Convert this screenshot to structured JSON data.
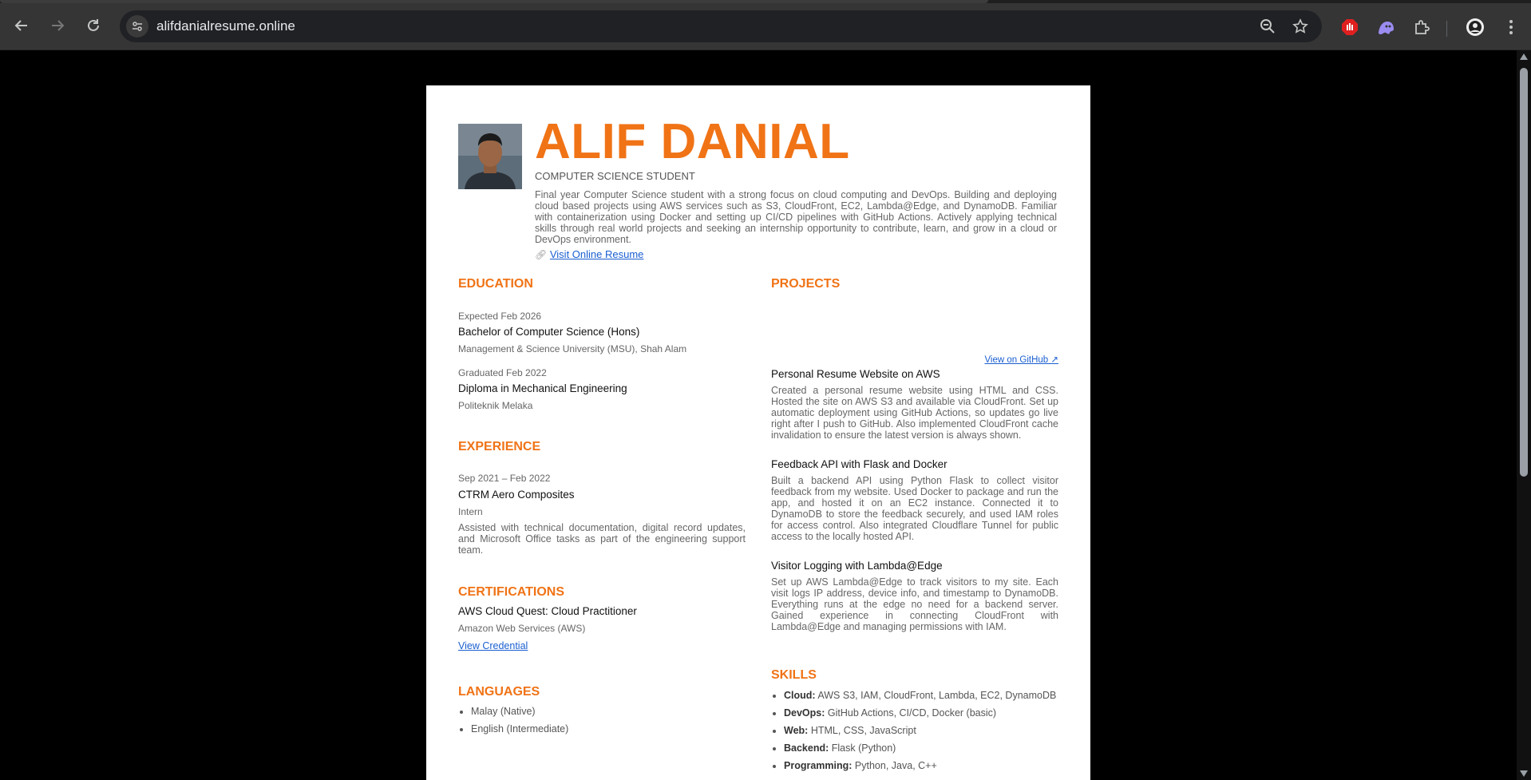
{
  "browser": {
    "url": "alifdanialresume.online",
    "colors": {
      "toolbar": "#353535",
      "omnibox": "#202124"
    }
  },
  "resume": {
    "name": "ALIF DANIAL",
    "subtitle": "COMPUTER SCIENCE STUDENT",
    "summary": "Final year Computer Science student with a strong focus on cloud computing and DevOps. Building and deploying cloud based projects using AWS services such as S3, CloudFront, EC2, Lambda@Edge, and DynamoDB. Familiar with containerization using Docker and setting up CI/CD pipelines with GitHub Actions. Actively applying technical skills through real world projects and seeking an internship opportunity to contribute, learn, and grow in a cloud or DevOps environment.",
    "online_link": "Visit Online Resume",
    "accent_color": "#f07316",
    "education": {
      "heading": "EDUCATION",
      "items": [
        {
          "date": "Expected Feb 2026",
          "degree": "Bachelor of Computer Science (Hons)",
          "school": "Management & Science University (MSU), Shah Alam"
        },
        {
          "date": "Graduated Feb 2022",
          "degree": "Diploma in Mechanical Engineering",
          "school": "Politeknik Melaka"
        }
      ]
    },
    "experience": {
      "heading": "EXPERIENCE",
      "date": "Sep 2021 – Feb 2022",
      "company": "CTRM Aero Composites",
      "role": "Intern",
      "desc": "Assisted with technical documentation, digital record updates, and Microsoft Office tasks as part of the engineering support team."
    },
    "certifications": {
      "heading": "CERTIFICATIONS",
      "name": "AWS Cloud Quest: Cloud Practitioner",
      "issuer": "Amazon Web Services (AWS)",
      "link": "View Credential"
    },
    "languages": {
      "heading": "LANGUAGES",
      "items": [
        "Malay (Native)",
        "English (Intermediate)"
      ]
    },
    "projects": {
      "heading": "PROJECTS",
      "github_link": "View on GitHub ↗",
      "items": [
        {
          "title": "Personal Resume Website on AWS",
          "desc": "Created a personal resume website using HTML and CSS. Hosted the site on AWS S3 and available via CloudFront. Set up automatic deployment using GitHub Actions, so updates go live right after I push to GitHub. Also implemented CloudFront cache invalidation to ensure the latest version is always shown."
        },
        {
          "title": "Feedback API with Flask and Docker",
          "desc": "Built a backend API using Python Flask to collect visitor feedback from my website. Used Docker to package and run the app, and hosted it on an EC2 instance. Connected it to DynamoDB to store the feedback securely, and used IAM roles for access control. Also integrated Cloudflare Tunnel for public access to the locally hosted API."
        },
        {
          "title": "Visitor Logging with Lambda@Edge",
          "desc": "Set up AWS Lambda@Edge to track visitors to my site. Each visit logs IP address, device info, and timestamp to DynamoDB. Everything runs at the edge no need for a backend server. Gained experience in connecting CloudFront with Lambda@Edge and managing permissions with IAM."
        }
      ]
    },
    "skills": {
      "heading": "SKILLS",
      "items": [
        {
          "label": "Cloud:",
          "value": "AWS S3, IAM, CloudFront, Lambda, EC2, DynamoDB"
        },
        {
          "label": "DevOps:",
          "value": "GitHub Actions, CI/CD, Docker (basic)"
        },
        {
          "label": "Web:",
          "value": "HTML, CSS, JavaScript"
        },
        {
          "label": "Backend:",
          "value": "Flask (Python)"
        },
        {
          "label": "Programming:",
          "value": "Python, Java, C++"
        }
      ]
    }
  }
}
